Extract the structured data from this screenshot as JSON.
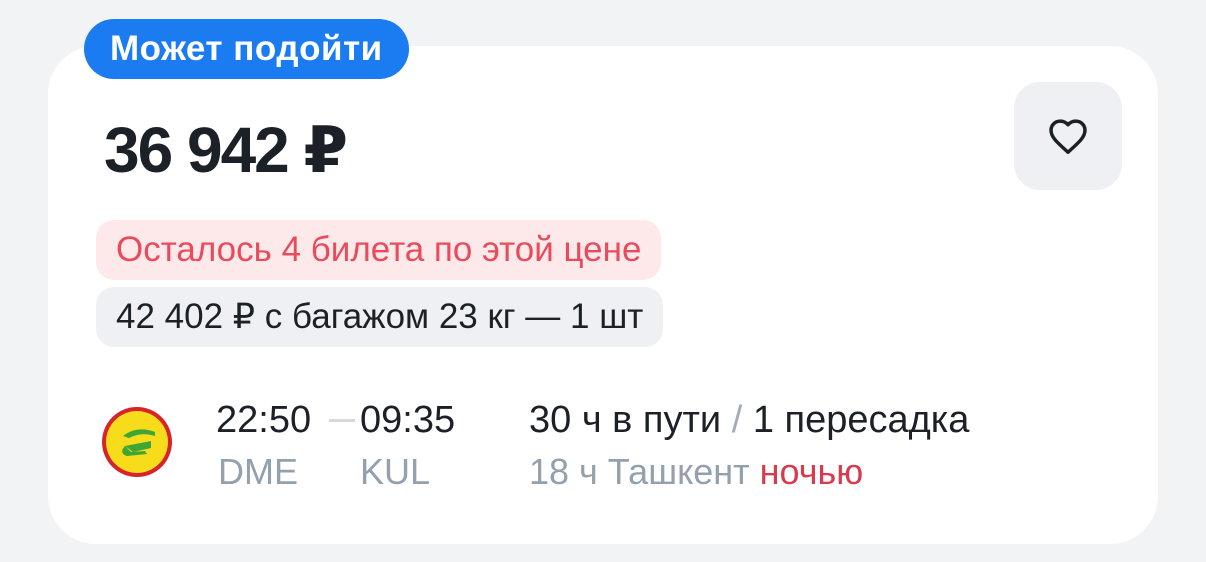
{
  "badge": {
    "label": "Может подойти"
  },
  "offer": {
    "price": "36 942 ₽",
    "tickets_left": "Осталось 4 билета по этой цене",
    "baggage_option": "42 402 ₽ с багажом 23 кг — 1 шт"
  },
  "favorite": {
    "icon": "heart-icon"
  },
  "flight": {
    "airline_logo": "airline-logo-icon",
    "departure_time": "22:50",
    "arrival_time": "09:35",
    "departure_airport": "DME",
    "arrival_airport": "KUL",
    "duration": "30 ч в пути",
    "separator": "/",
    "stops": "1 пересадка",
    "layover": "18 ч Ташкент",
    "layover_note": "ночью"
  },
  "colors": {
    "background": "#f2f3f5",
    "card": "#ffffff",
    "badge": "#1a7cf0",
    "warning_text": "#ea4b5c",
    "warning_bg": "#fde8ea",
    "night_text": "#d93a4e",
    "muted_text": "#93a0ad",
    "primary_text": "#1c2128"
  }
}
